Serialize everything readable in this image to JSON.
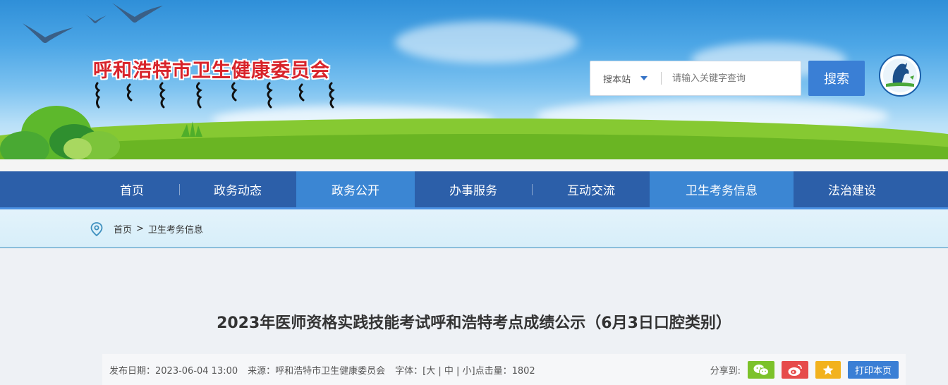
{
  "header": {
    "site_title": "呼和浩特市卫生健康委员会",
    "search": {
      "scope_label": "搜本站",
      "placeholder": "请输入关键字查询",
      "button_label": "搜索"
    }
  },
  "nav": {
    "items": [
      {
        "label": "首页"
      },
      {
        "label": "政务动态"
      },
      {
        "label": "政务公开"
      },
      {
        "label": "办事服务"
      },
      {
        "label": "互动交流"
      },
      {
        "label": "卫生考务信息"
      },
      {
        "label": "法治建设"
      }
    ]
  },
  "breadcrumb": {
    "home": "首页",
    "separator": ">",
    "current": "卫生考务信息"
  },
  "article": {
    "title": "2023年医师资格实践技能考试呼和浩特考点成绩公示（6月3日口腔类别）",
    "meta": {
      "publish": "发布日期：2023-06-04 13:00",
      "source": "来源：呼和浩特市卫生健康委员会",
      "font_size": "字体：[大 | 中 | 小]点击量：1802"
    },
    "share": {
      "label": "分享到:",
      "print_label": "打印本页",
      "icons": [
        "wechat-icon",
        "weibo-icon",
        "favorite-star-icon"
      ]
    }
  },
  "colors": {
    "nav_bg": "#2c5fa9",
    "nav_active": "#3b86d3",
    "title_red": "#d8232a",
    "button_blue": "#3a7fd5"
  }
}
